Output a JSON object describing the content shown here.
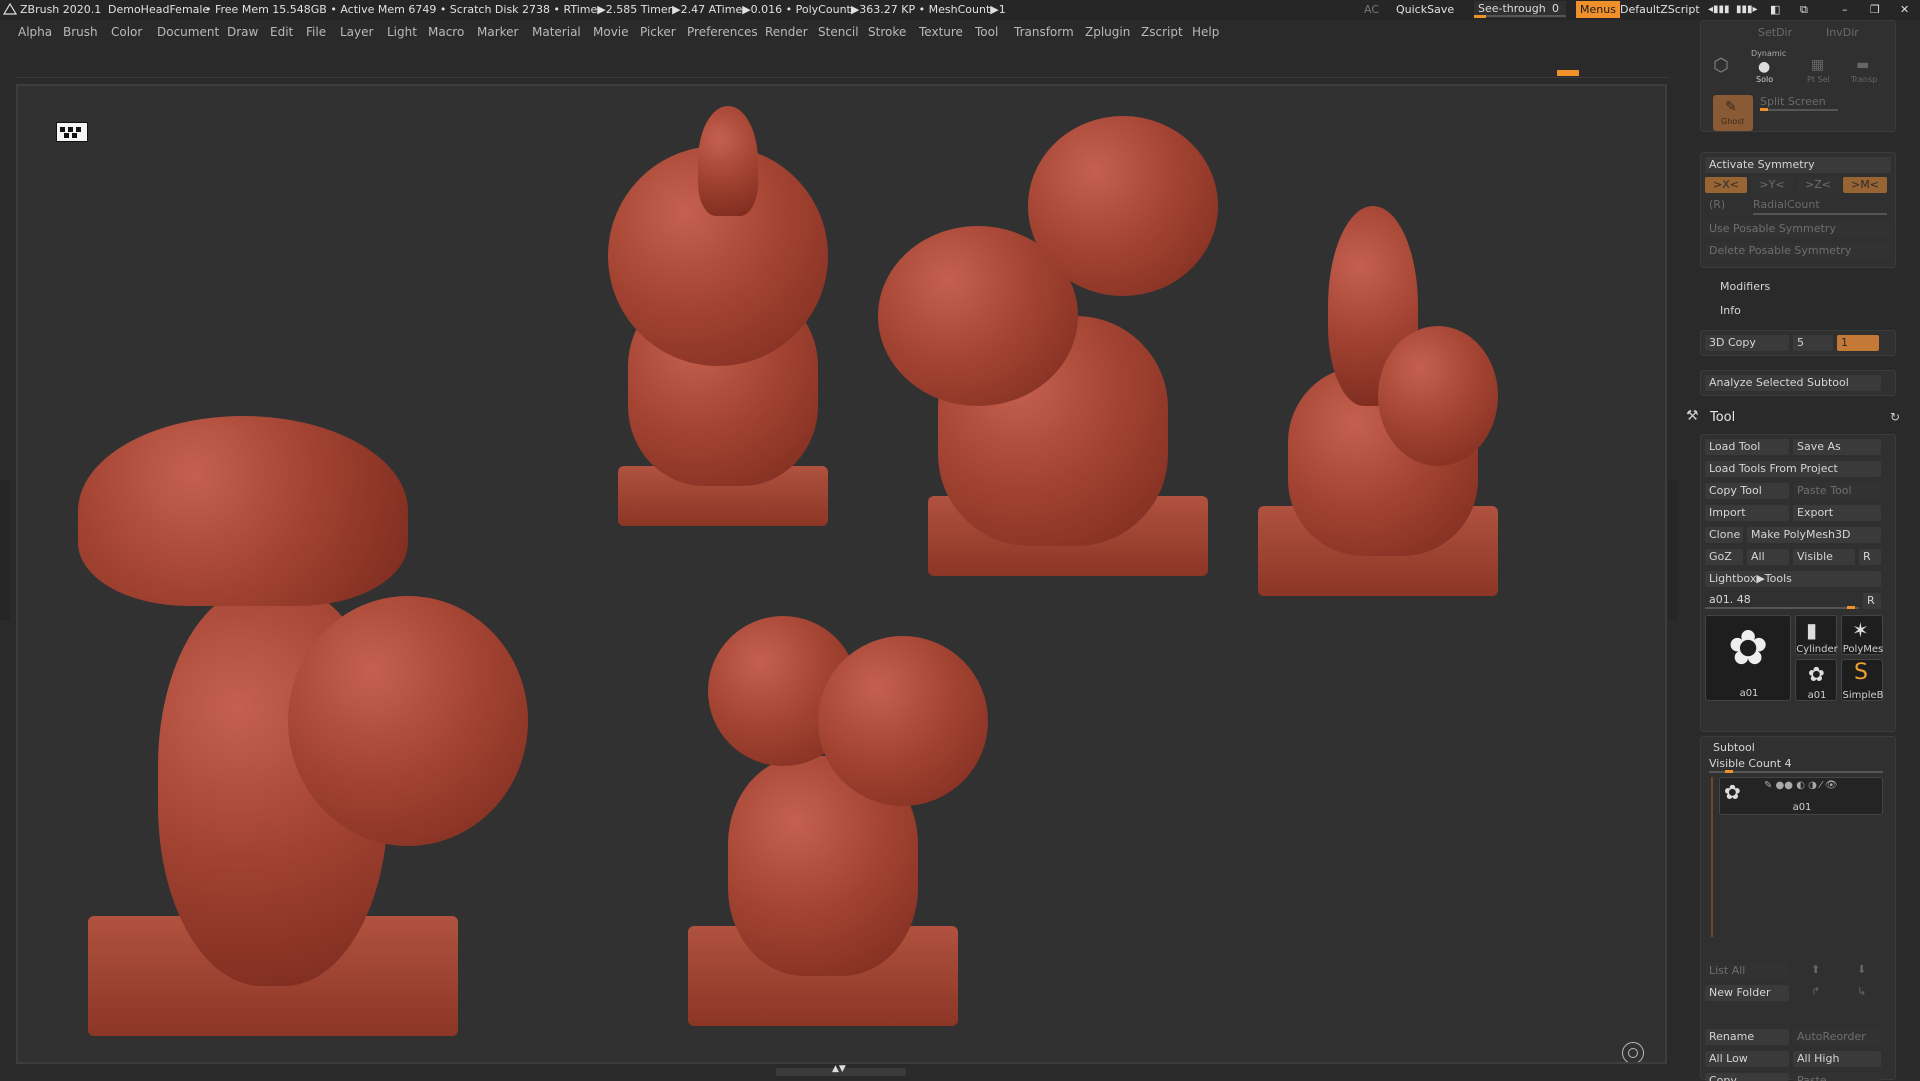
{
  "titlebar": {
    "app": "ZBrush 2020.1",
    "project": "DemoHeadFemale",
    "stats": "• Free Mem 15.548GB • Active Mem 6749 • Scratch Disk 2738 •  RTime▶2.585 Timer▶2.47 ATime▶0.016 • PolyCount▶363.27 KP  • MeshCount▶1",
    "ac": "AC",
    "quicksave": "QuickSave",
    "see_through_label": "See-through",
    "see_through_value": "0",
    "menus": "Menus",
    "zscript": "DefaultZScript"
  },
  "menubar": {
    "items": [
      "Alpha",
      "Brush",
      "Color",
      "Document",
      "Draw",
      "Edit",
      "File",
      "Layer",
      "Light",
      "Macro",
      "Marker",
      "Material",
      "Movie",
      "Picker",
      "Preferences",
      "Render",
      "Stencil",
      "Stroke",
      "Texture",
      "Tool",
      "Transform",
      "Zplugin",
      "Zscript",
      "Help"
    ]
  },
  "panel": {
    "setdir": "SetDir",
    "invdir": "InvDir",
    "dynamic": "Dynamic",
    "solo": "Solo",
    "ptsel": "Pt Sel",
    "transp": "Transp",
    "ghost": "Ghost",
    "split_screen": "Split Screen",
    "activate_symmetry": "Activate Symmetry",
    "sym_x": ">X<",
    "sym_y": ">Y<",
    "sym_z": ">Z<",
    "sym_m": ">M<",
    "radial_r": "(R)",
    "radial_count": "RadialCount",
    "use_posable": "Use Posable Symmetry",
    "delete_posable": "Delete Posable Symmetry",
    "modifiers": "Modifiers",
    "info": "Info",
    "copy3d": "3D Copy",
    "copy3d_value": "5",
    "copy3d_field": "1",
    "analyze": "Analyze Selected Subtool",
    "tool_title": "Tool",
    "load_tool": "Load Tool",
    "save_as": "Save As",
    "load_from_project": "Load Tools From Project",
    "copy_tool": "Copy Tool",
    "paste_tool": "Paste Tool",
    "import": "Import",
    "export": "Export",
    "clone": "Clone",
    "make_polymesh": "Make PolyMesh3D",
    "goz": "GoZ",
    "all": "All",
    "visible": "Visible",
    "r": "R",
    "lightbox_tools": "Lightbox▶Tools",
    "tool_name_value": "a01. 48",
    "thumb_main": "a01",
    "thumb_cylinder": "Cylinder",
    "thumb_polymesh": "PolyMes",
    "thumb_a01": "a01",
    "thumb_simple": "SimpleB",
    "subtool": "Subtool",
    "visible_count": "Visible Count 4",
    "subtool_item": "a01",
    "list_all": "List All",
    "new_folder": "New Folder",
    "rename": "Rename",
    "auto_reorder": "AutoReorder",
    "all_low": "All Low",
    "all_high": "All High",
    "copy": "Copy",
    "paste": "Paste"
  },
  "colors": {
    "accent": "#f0902a",
    "sculpt": "#a44433",
    "background": "#313131"
  }
}
